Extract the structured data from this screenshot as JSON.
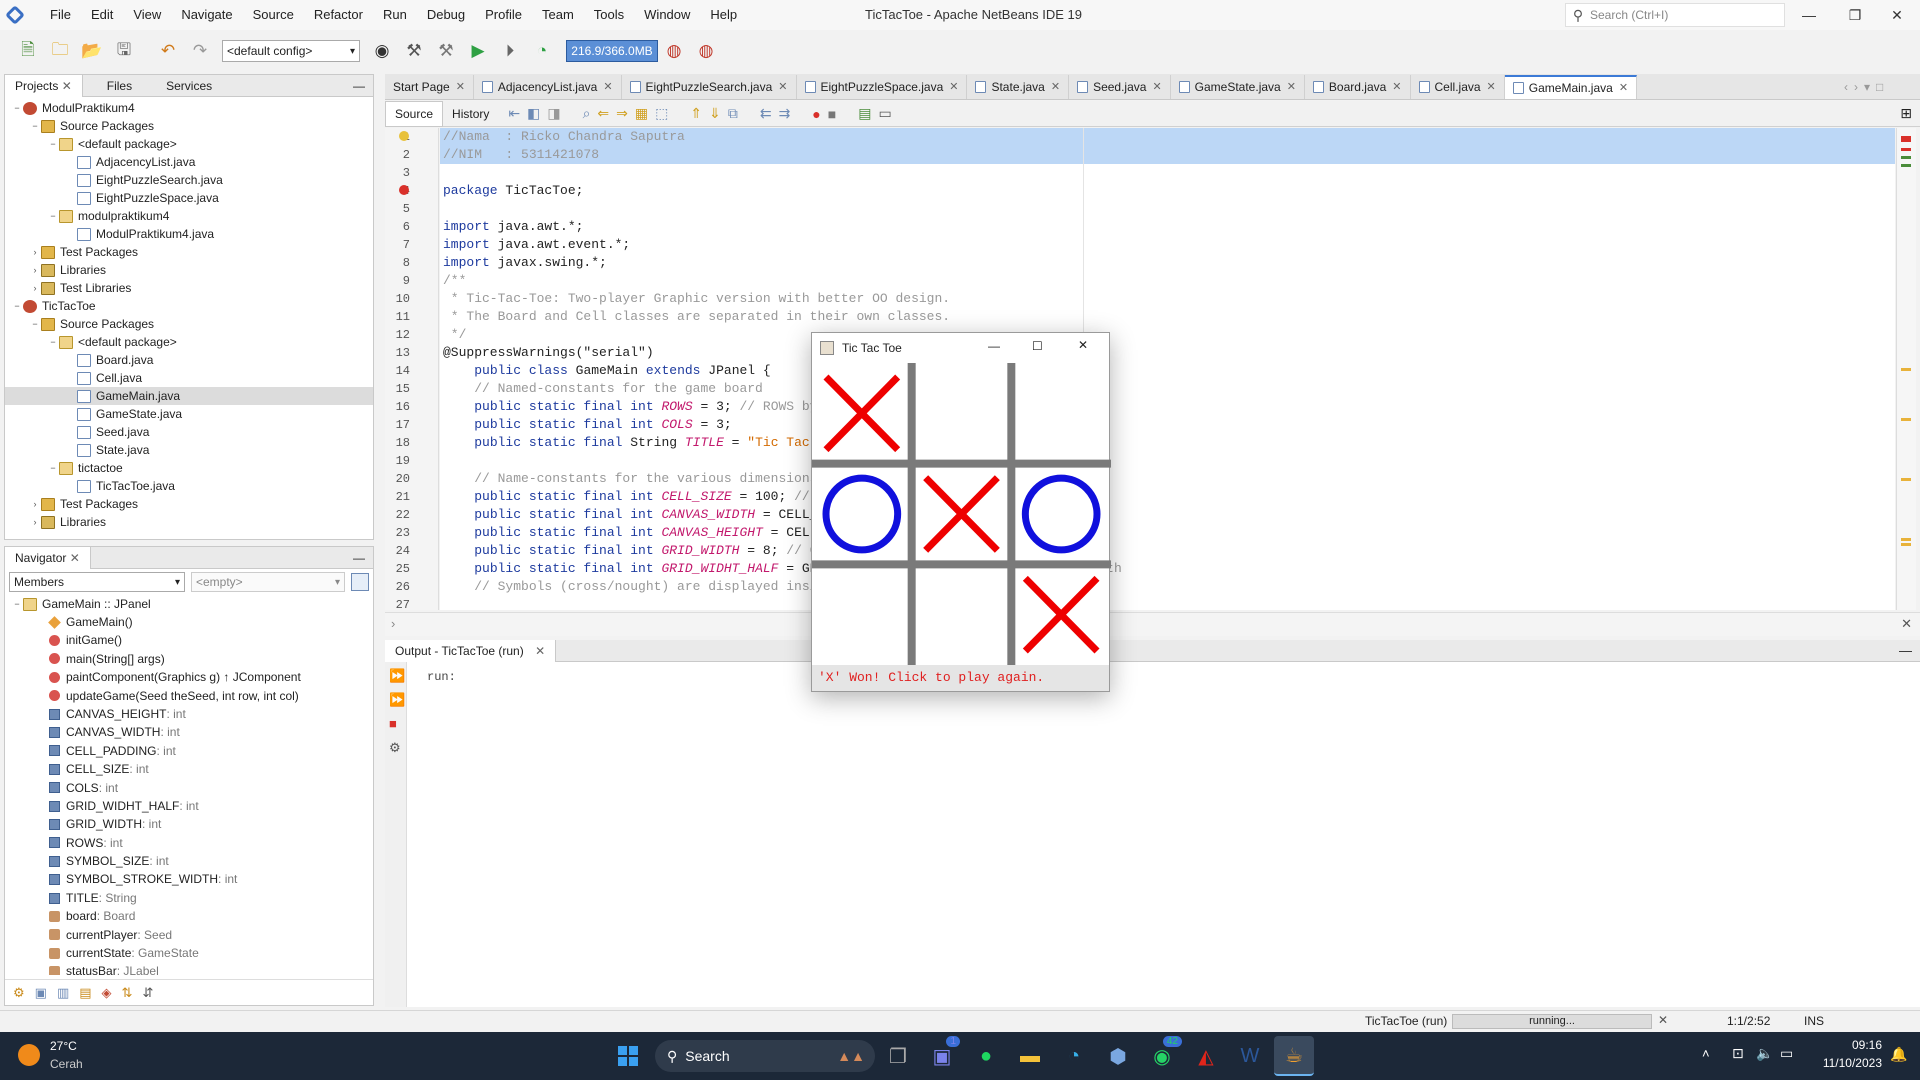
{
  "window": {
    "title": "TicTacToe - Apache NetBeans IDE 19",
    "search_placeholder": "Search (Ctrl+I)",
    "menu": [
      "File",
      "Edit",
      "View",
      "Navigate",
      "Source",
      "Refactor",
      "Run",
      "Debug",
      "Profile",
      "Team",
      "Tools",
      "Window",
      "Help"
    ]
  },
  "toolbar": {
    "config": "<default config>",
    "memory": "216.9/366.0MB"
  },
  "projects_panel": {
    "tabs": [
      "Projects",
      "Files",
      "Services"
    ],
    "tree": [
      {
        "label": "ModulPraktikum4",
        "depth": 0,
        "icon": "proj",
        "tw": "−"
      },
      {
        "label": "Source Packages",
        "depth": 1,
        "icon": "pkgfold",
        "tw": "−"
      },
      {
        "label": "<default package>",
        "depth": 2,
        "icon": "pkg",
        "tw": "−"
      },
      {
        "label": "AdjacencyList.java",
        "depth": 3,
        "icon": "java",
        "tw": ""
      },
      {
        "label": "EightPuzzleSearch.java",
        "depth": 3,
        "icon": "java",
        "tw": ""
      },
      {
        "label": "EightPuzzleSpace.java",
        "depth": 3,
        "icon": "java",
        "tw": ""
      },
      {
        "label": "modulpraktikum4",
        "depth": 2,
        "icon": "pkg",
        "tw": "−"
      },
      {
        "label": "ModulPraktikum4.java",
        "depth": 3,
        "icon": "java",
        "tw": ""
      },
      {
        "label": "Test Packages",
        "depth": 1,
        "icon": "pkgfold",
        "tw": "›"
      },
      {
        "label": "Libraries",
        "depth": 1,
        "icon": "lib",
        "tw": "›"
      },
      {
        "label": "Test Libraries",
        "depth": 1,
        "icon": "lib",
        "tw": "›"
      },
      {
        "label": "TicTacToe",
        "depth": 0,
        "icon": "proj",
        "tw": "−"
      },
      {
        "label": "Source Packages",
        "depth": 1,
        "icon": "pkgfold",
        "tw": "−"
      },
      {
        "label": "<default package>",
        "depth": 2,
        "icon": "pkg",
        "tw": "−"
      },
      {
        "label": "Board.java",
        "depth": 3,
        "icon": "java",
        "tw": ""
      },
      {
        "label": "Cell.java",
        "depth": 3,
        "icon": "java",
        "tw": ""
      },
      {
        "label": "GameMain.java",
        "depth": 3,
        "icon": "java",
        "tw": "",
        "selected": true
      },
      {
        "label": "GameState.java",
        "depth": 3,
        "icon": "java",
        "tw": ""
      },
      {
        "label": "Seed.java",
        "depth": 3,
        "icon": "java",
        "tw": ""
      },
      {
        "label": "State.java",
        "depth": 3,
        "icon": "java",
        "tw": ""
      },
      {
        "label": "tictactoe",
        "depth": 2,
        "icon": "pkg",
        "tw": "−"
      },
      {
        "label": "TicTacToe.java",
        "depth": 3,
        "icon": "java",
        "tw": ""
      },
      {
        "label": "Test Packages",
        "depth": 1,
        "icon": "pkgfold",
        "tw": "›"
      },
      {
        "label": "Libraries",
        "depth": 1,
        "icon": "lib",
        "tw": "›"
      }
    ]
  },
  "navigator_panel": {
    "tab": "Navigator",
    "filter": "Members",
    "empty_select": "<empty>",
    "root": "GameMain :: JPanel",
    "members": [
      {
        "kind": "ctor",
        "name": "GameMain()",
        "type": ""
      },
      {
        "kind": "meth",
        "name": "initGame()",
        "type": ""
      },
      {
        "kind": "meth",
        "name": "main(String[] args)",
        "type": ""
      },
      {
        "kind": "meth",
        "name": "paintComponent(Graphics g) ↑ JComponent",
        "type": ""
      },
      {
        "kind": "meth",
        "name": "updateGame(Seed theSeed, int row, int col)",
        "type": ""
      },
      {
        "kind": "field",
        "name": "CANVAS_HEIGHT",
        "type": " : int"
      },
      {
        "kind": "field",
        "name": "CANVAS_WIDTH",
        "type": " : int"
      },
      {
        "kind": "field",
        "name": "CELL_PADDING",
        "type": " : int"
      },
      {
        "kind": "field",
        "name": "CELL_SIZE",
        "type": " : int"
      },
      {
        "kind": "field",
        "name": "COLS",
        "type": " : int"
      },
      {
        "kind": "field",
        "name": "GRID_WIDHT_HALF",
        "type": " : int"
      },
      {
        "kind": "field",
        "name": "GRID_WIDTH",
        "type": " : int"
      },
      {
        "kind": "field",
        "name": "ROWS",
        "type": " : int"
      },
      {
        "kind": "field",
        "name": "SYMBOL_SIZE",
        "type": " : int"
      },
      {
        "kind": "field",
        "name": "SYMBOL_STROKE_WIDTH",
        "type": " : int"
      },
      {
        "kind": "field",
        "name": "TITLE",
        "type": " : String"
      },
      {
        "kind": "ofield",
        "name": "board",
        "type": " : Board"
      },
      {
        "kind": "ofield",
        "name": "currentPlayer",
        "type": " : Seed"
      },
      {
        "kind": "ofield",
        "name": "currentState",
        "type": " : GameState"
      },
      {
        "kind": "ofield",
        "name": "statusBar",
        "type": " : JLabel"
      }
    ]
  },
  "editor": {
    "tabs": [
      "Start Page",
      "AdjacencyList.java",
      "EightPuzzleSearch.java",
      "EightPuzzleSpace.java",
      "State.java",
      "Seed.java",
      "GameState.java",
      "Board.java",
      "Cell.java",
      "GameMain.java"
    ],
    "active_tab": "GameMain.java",
    "subtabs": [
      "Source",
      "History"
    ],
    "lines": [
      [
        [
          "cm",
          "//Nama  : Ricko Chandra Saputra"
        ]
      ],
      [
        [
          "cm",
          "//NIM   : 5311421078"
        ]
      ],
      [],
      [
        [
          "kw",
          "package"
        ],
        [
          "",
          "TicTacToe;"
        ]
      ],
      [],
      [
        [
          "kw",
          "import"
        ],
        [
          "",
          "java.awt.*;"
        ]
      ],
      [
        [
          "kw",
          "import"
        ],
        [
          "",
          "java.awt.event.*;"
        ]
      ],
      [
        [
          "kw",
          "import"
        ],
        [
          "",
          "javax.swing.*;"
        ]
      ],
      [
        [
          "cm",
          "/**"
        ]
      ],
      [
        [
          "cm",
          " * Tic-Tac-Toe: Two-player Graphic version with better OO design."
        ]
      ],
      [
        [
          "cm",
          " * The Board and Cell classes are separated in their own classes."
        ]
      ],
      [
        [
          "cm",
          " */"
        ]
      ],
      [
        [
          "ann",
          "@SuppressWarnings(\"serial\")"
        ]
      ],
      [
        [
          "",
          "    "
        ],
        [
          "kw",
          "public class"
        ],
        [
          "",
          "GameMain"
        ],
        [
          "kw",
          "extends"
        ],
        [
          "",
          "JPanel {"
        ]
      ],
      [
        [
          "cm",
          "    // Named-constants for the game board"
        ]
      ],
      [
        [
          "",
          "    "
        ],
        [
          "kw",
          "public static final int"
        ],
        [
          "fld",
          "ROWS"
        ],
        [
          "",
          "= 3; "
        ],
        [
          "cm",
          "// ROWS by COLS cells"
        ]
      ],
      [
        [
          "",
          "    "
        ],
        [
          "kw",
          "public static final int"
        ],
        [
          "fld",
          "COLS"
        ],
        [
          "",
          "= 3;"
        ]
      ],
      [
        [
          "",
          "    "
        ],
        [
          "kw",
          "public static final"
        ],
        [
          "",
          "String"
        ],
        [
          "fld",
          "TITLE"
        ],
        [
          "",
          "="
        ],
        [
          "str",
          "\"Tic Tac Toe\""
        ],
        [
          ";",
          ";"
        ]
      ],
      [],
      [
        [
          "cm",
          "    // Name-constants for the various dimensions used for graphics drawing"
        ]
      ],
      [
        [
          "",
          "    "
        ],
        [
          "kw",
          "public static final int"
        ],
        [
          "fld",
          "CELL_SIZE"
        ],
        [
          "",
          "= 100; "
        ],
        [
          "cm",
          "// cell width and height (square)"
        ]
      ],
      [
        [
          "",
          "    "
        ],
        [
          "kw",
          "public static final int"
        ],
        [
          "fld",
          "CANVAS_WIDTH"
        ],
        [
          "",
          "= CELL_SIZE * COLS;"
        ]
      ],
      [
        [
          "",
          "    "
        ],
        [
          "kw",
          "public static final int"
        ],
        [
          "fld",
          "CANVAS_HEIGHT"
        ],
        [
          "",
          "= CELL_SIZE * ROWS;"
        ]
      ],
      [
        [
          "",
          "    "
        ],
        [
          "kw",
          "public static final int"
        ],
        [
          "fld",
          "GRID_WIDTH"
        ],
        [
          "",
          "= 8; "
        ],
        [
          "cm",
          "// Grid-line's width"
        ]
      ],
      [
        [
          "",
          "    "
        ],
        [
          "kw",
          "public static final int"
        ],
        [
          "fld",
          "GRID_WIDHT_HALF"
        ],
        [
          "",
          "= GRID_WIDTH / 2; "
        ],
        [
          "cm",
          "// Grid-line's half-width"
        ]
      ],
      [
        [
          "cm",
          "    // Symbols (cross/nought) are displayed inside a cell, with padding from border"
        ]
      ],
      []
    ]
  },
  "output": {
    "tab": "Output - TicTacToe (run)",
    "text": "run:"
  },
  "statusbar": {
    "task": "TicTacToe (run)",
    "progress": "running...",
    "position": "1:1/2:52",
    "mode": "INS"
  },
  "tictactoe_window": {
    "title": "Tic Tac Toe",
    "board": [
      "X",
      "",
      "",
      "O",
      "X",
      "O",
      "",
      "",
      "X"
    ],
    "status": "'X' Won! Click to play again.",
    "colors": {
      "cross": "#ee0000",
      "nought": "#1010dd",
      "grid": "#7a7a7a",
      "status": "#e02020"
    }
  },
  "taskbar": {
    "weather_temp": "27°C",
    "weather_text": "Cerah",
    "search": "Search",
    "time": "09:16",
    "date": "11/10/2023",
    "badge_teams": "1",
    "badge_whatsapp": "42"
  }
}
